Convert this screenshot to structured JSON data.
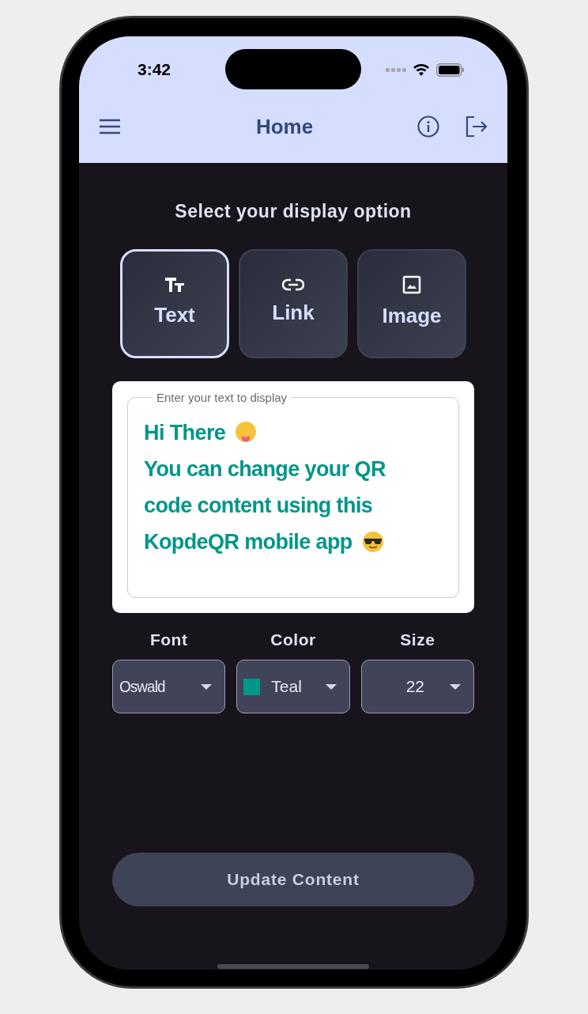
{
  "status_bar": {
    "time": "3:42"
  },
  "app_bar": {
    "title": "Home"
  },
  "heading": "Select your display option",
  "options": [
    {
      "label": "Text",
      "kind": "text",
      "selected": true
    },
    {
      "label": "Link",
      "kind": "link",
      "selected": false
    },
    {
      "label": "Image",
      "kind": "image",
      "selected": false
    }
  ],
  "text_input": {
    "label": "Enter your text to display",
    "color": "#009688",
    "lines": [
      {
        "text": "Hi There",
        "kind": "tongue-emoji"
      },
      {
        "text": "You can change your QR",
        "kind": "plain"
      },
      {
        "text": "code content using this",
        "kind": "plain"
      },
      {
        "text": "KopdeQR mobile app",
        "kind": "sunglasses-emoji"
      }
    ]
  },
  "selectors": [
    {
      "label": "Font",
      "value": "Oswald",
      "kind": "font"
    },
    {
      "label": "Color",
      "value": "Teal",
      "kind": "color",
      "color": "#009688"
    },
    {
      "label": "Size",
      "value": "22",
      "kind": "size"
    }
  ],
  "update_button": "Update Content"
}
